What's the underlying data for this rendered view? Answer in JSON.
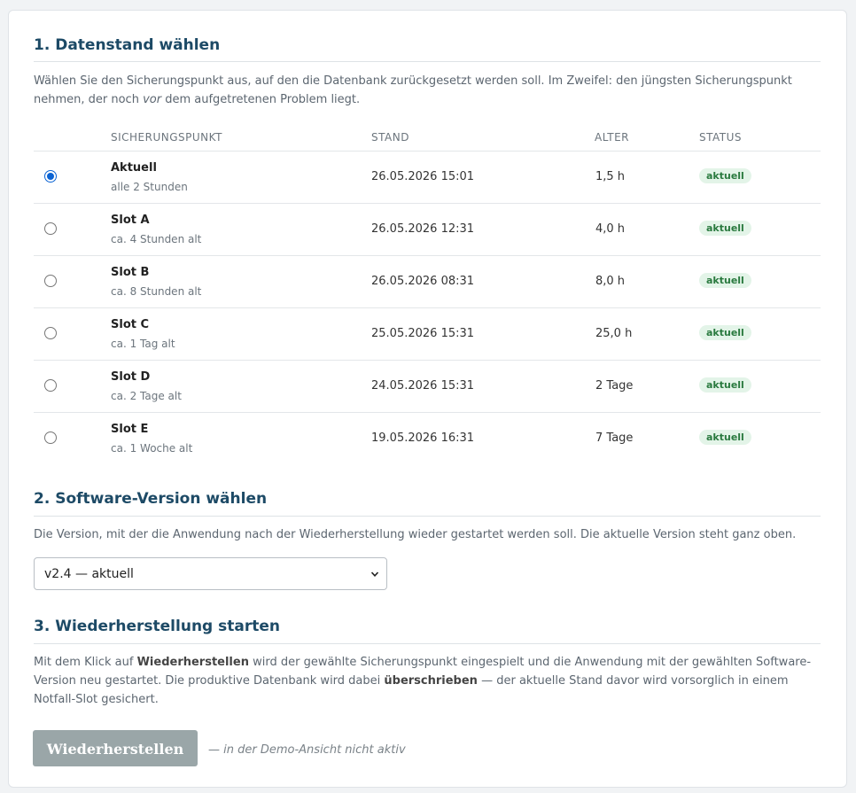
{
  "section1": {
    "title": "1. Datenstand wählen",
    "intro_a": "Wählen Sie den Sicherungspunkt aus, auf den die Datenbank zurückgesetzt werden soll. Im Zweifel: den jüngsten Sicherungspunkt nehmen, der noch ",
    "intro_em": "vor",
    "intro_b": " dem aufgetretenen Problem liegt."
  },
  "table": {
    "headers": {
      "slot": "SICHERUNGSPUNKT",
      "stand": "STAND",
      "alter": "ALTER",
      "status": "STATUS"
    },
    "rows": [
      {
        "name": "Aktuell",
        "sub": "alle 2 Stunden",
        "stand": "26.05.2026 15:01",
        "alter": "1,5 h",
        "status": "aktuell",
        "selected": true
      },
      {
        "name": "Slot A",
        "sub": "ca. 4 Stunden alt",
        "stand": "26.05.2026 12:31",
        "alter": "4,0 h",
        "status": "aktuell",
        "selected": false
      },
      {
        "name": "Slot B",
        "sub": "ca. 8 Stunden alt",
        "stand": "26.05.2026 08:31",
        "alter": "8,0 h",
        "status": "aktuell",
        "selected": false
      },
      {
        "name": "Slot C",
        "sub": "ca. 1 Tag alt",
        "stand": "25.05.2026 15:31",
        "alter": "25,0 h",
        "status": "aktuell",
        "selected": false
      },
      {
        "name": "Slot D",
        "sub": "ca. 2 Tage alt",
        "stand": "24.05.2026 15:31",
        "alter": "2 Tage",
        "status": "aktuell",
        "selected": false
      },
      {
        "name": "Slot E",
        "sub": "ca. 1 Woche alt",
        "stand": "19.05.2026 16:31",
        "alter": "7 Tage",
        "status": "aktuell",
        "selected": false
      }
    ]
  },
  "section2": {
    "title": "2. Software-Version wählen",
    "intro": "Die Version, mit der die Anwendung nach der Wiederherstellung wieder gestartet werden soll. Die aktuelle Version steht ganz oben.",
    "select_value": "v2.4 — aktuell"
  },
  "section3": {
    "title": "3. Wiederherstellung starten",
    "p1": "Mit dem Klick auf ",
    "b1": "Wiederherstellen",
    "p2": " wird der gewählte Sicherungspunkt eingespielt und die Anwendung mit der gewählten Software-Version neu gestartet. Die produktive Datenbank wird dabei ",
    "b2": "überschrieben",
    "p3": " — der aktuelle Stand davor wird vorsorglich in einem Notfall-Slot gesichert.",
    "button_label": "Wiederherstellen",
    "button_note": "— in der Demo-Ansicht nicht aktiv"
  },
  "colors": {
    "heading": "#1d4a66",
    "radio_selected": "#0b63d3",
    "badge_text": "#2a7a3f",
    "badge_bg": "#e3f4e8",
    "button_disabled": "#9aa6a8"
  },
  "icons": {
    "select": "chevron-down-icon"
  }
}
